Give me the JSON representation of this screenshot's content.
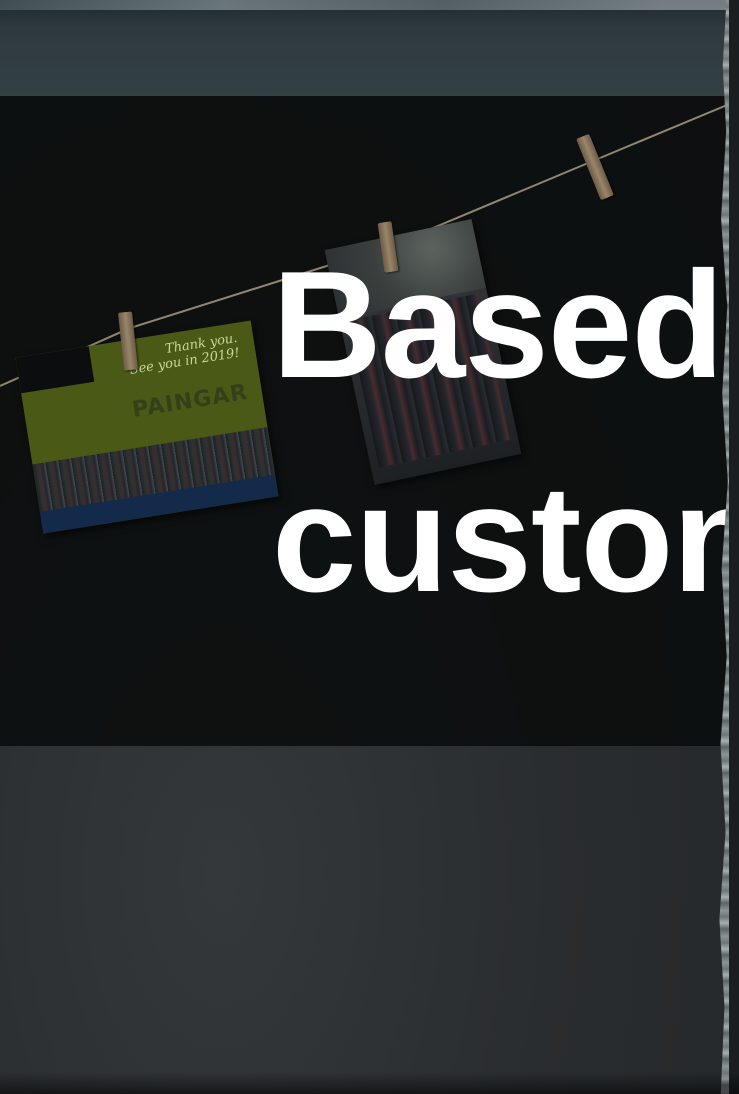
{
  "headline": {
    "line1": "Based",
    "line2": "custon"
  },
  "photo_left": {
    "caption_line1": "Thank you.",
    "caption_line2": "See you in 2019!",
    "brand_text": "PAINGAR"
  },
  "colors": {
    "overlay": "#0a0c0d",
    "text": "#ffffff",
    "photo_green": "#8aa62a"
  }
}
